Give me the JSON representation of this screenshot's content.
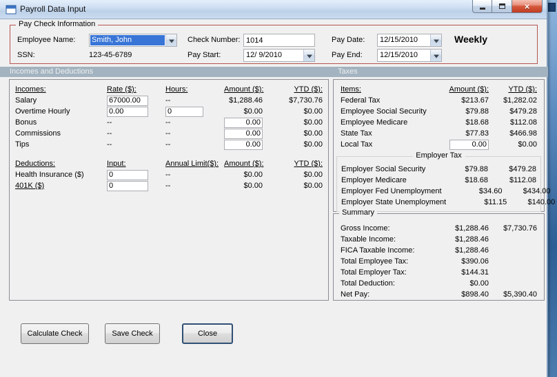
{
  "window": {
    "title": "Payroll Data Input",
    "controls": {
      "close_glyph": "×"
    }
  },
  "colors": {
    "selection_blue": "#3875d7",
    "section_header_bg": "#a3b3bf",
    "paycheck_group_border": "#b4544e",
    "close_button_red": "#c23c22"
  },
  "paycheck_info": {
    "legend": "Pay Check Information",
    "employee_name_label": "Employee Name:",
    "employee_name_value": "Smith, John",
    "ssn_label": "SSN:",
    "ssn_value": "123-45-6789",
    "check_number_label": "Check Number:",
    "check_number_value": "1014",
    "pay_start_label": "Pay Start:",
    "pay_start_value": "12/ 9/2010",
    "pay_date_label": "Pay Date:",
    "pay_date_value": "12/15/2010",
    "pay_end_label": "Pay End:",
    "pay_end_value": "12/15/2010",
    "frequency": "Weekly"
  },
  "section_headers": {
    "left": "Incomes and Deductions",
    "right": "Taxes"
  },
  "incomes": {
    "headers": {
      "name": "Incomes:",
      "rate": "Rate ($):",
      "hours": "Hours:",
      "amount": "Amount ($):",
      "ytd": "YTD ($):"
    },
    "rows": [
      {
        "label": "Salary",
        "rate": "67000.00",
        "hours": "--",
        "amount": "$1,288.46",
        "ytd": "$7,730.76"
      },
      {
        "label": "Overtime Hourly",
        "rate": "0.00",
        "hours": "0",
        "amount": "$0.00",
        "ytd": "$0.00"
      },
      {
        "label": "Bonus",
        "rate": "--",
        "hours": "--",
        "amount": "0.00",
        "ytd": "$0.00"
      },
      {
        "label": "Commissions",
        "rate": "--",
        "hours": "--",
        "amount": "0.00",
        "ytd": "$0.00"
      },
      {
        "label": "Tips",
        "rate": "--",
        "hours": "--",
        "amount": "0.00",
        "ytd": "$0.00"
      }
    ]
  },
  "deductions": {
    "headers": {
      "name": "Deductions:",
      "input": "Input:",
      "limit": "Annual Limit($):",
      "amount": "Amount ($):",
      "ytd": "YTD ($):"
    },
    "rows": [
      {
        "label": "Health Insurance ($)",
        "input": "0",
        "limit": "--",
        "amount": "$0.00",
        "ytd": "$0.00"
      },
      {
        "label": "401K ($)",
        "input": "0",
        "limit": "--",
        "amount": "$0.00",
        "ytd": "$0.00"
      }
    ]
  },
  "taxes": {
    "headers": {
      "items": "Items:",
      "amount": "Amount ($):",
      "ytd": "YTD ($):"
    },
    "employee_rows": [
      {
        "label": "Federal Tax",
        "amount": "$213.67",
        "ytd": "$1,282.02"
      },
      {
        "label": "Employee Social Security",
        "amount": "$79.88",
        "ytd": "$479.28"
      },
      {
        "label": "Employee Medicare",
        "amount": "$18.68",
        "ytd": "$112.08"
      },
      {
        "label": "State Tax",
        "amount": "$77.83",
        "ytd": "$466.98"
      },
      {
        "label": "Local Tax",
        "amount": "0.00",
        "ytd": "$0.00"
      }
    ],
    "employer_group_label": "Employer Tax",
    "employer_rows": [
      {
        "label": "Employer Social Security",
        "amount": "$79.88",
        "ytd": "$479.28"
      },
      {
        "label": "Employer Medicare",
        "amount": "$18.68",
        "ytd": "$112.08"
      },
      {
        "label": "Employer Fed Unemployment",
        "amount": "$34.60",
        "ytd": "$434.00"
      },
      {
        "label": "Employer State Unemployment",
        "amount": "$11.15",
        "ytd": "$140.00"
      }
    ]
  },
  "summary": {
    "legend": "Summary",
    "rows": [
      {
        "label": "Gross Income:",
        "amount": "$1,288.46",
        "ytd": "$7,730.76"
      },
      {
        "label": "Taxable Income:",
        "amount": "$1,288.46",
        "ytd": ""
      },
      {
        "label": "FICA Taxable Income:",
        "amount": "$1,288.46",
        "ytd": ""
      },
      {
        "label": "Total Employee Tax:",
        "amount": "$390.06",
        "ytd": ""
      },
      {
        "label": "Total Employer Tax:",
        "amount": "$144.31",
        "ytd": ""
      },
      {
        "label": "Total Deduction:",
        "amount": "$0.00",
        "ytd": ""
      },
      {
        "label": "Net Pay:",
        "amount": "$898.40",
        "ytd": "$5,390.40"
      }
    ]
  },
  "buttons": {
    "calculate": "Calculate Check",
    "save": "Save Check",
    "close": "Close"
  }
}
